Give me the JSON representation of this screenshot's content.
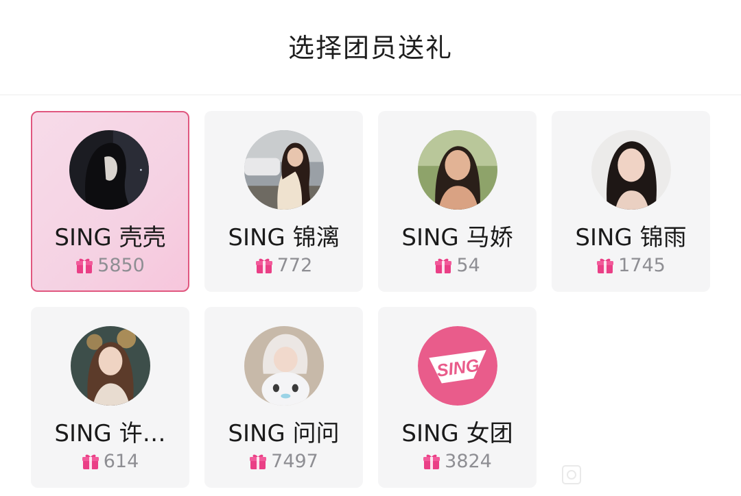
{
  "header": {
    "title": "选择团员送礼"
  },
  "members": [
    {
      "name": "SING 壳壳",
      "gifts": "5850",
      "selected": true
    },
    {
      "name": "SING 锦漓",
      "gifts": "772"
    },
    {
      "name": "SING 马娇",
      "gifts": "54"
    },
    {
      "name": "SING 锦雨",
      "gifts": "1745"
    },
    {
      "name": "SING 许…",
      "gifts": "614"
    },
    {
      "name": "SING 问问",
      "gifts": "7497"
    },
    {
      "name": "SING 女团",
      "gifts": "3824"
    }
  ],
  "logo": {
    "text": "SING"
  },
  "colors": {
    "accent": "#e0577f",
    "gift_icon": "#ea3f86",
    "selected_bg": "#f6d6e5",
    "card_bg": "#f5f5f6"
  }
}
